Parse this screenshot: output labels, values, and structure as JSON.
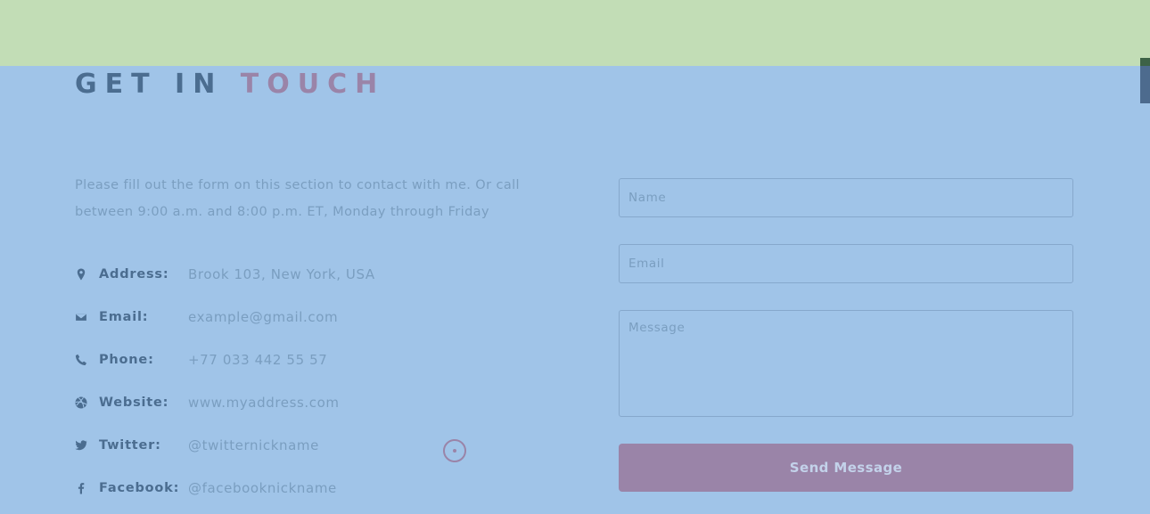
{
  "colors": {
    "background": "#a0c4e8",
    "top_band": "#c2ddb6",
    "heading": "#4b6d90",
    "accent": "#9a84a8",
    "muted_text": "#7a9ec0"
  },
  "section": {
    "title_part1": "GET IN",
    "title_part2": "TOUCH",
    "intro": "Please fill out the form on this section to contact with me. Or call between 9:00 a.m. and 8:00 p.m. ET, Monday through Friday"
  },
  "contact_info": [
    {
      "icon": "map-pin-icon",
      "label": "Address:",
      "value": "Brook 103, New York, USA"
    },
    {
      "icon": "envelope-icon",
      "label": "Email:",
      "value": "example@gmail.com"
    },
    {
      "icon": "phone-icon",
      "label": "Phone:",
      "value": "+77 033 442 55 57"
    },
    {
      "icon": "globe-icon",
      "label": "Website:",
      "value": "www.myaddress.com"
    },
    {
      "icon": "twitter-icon",
      "label": "Twitter:",
      "value": "@twitternickname"
    },
    {
      "icon": "facebook-icon",
      "label": "Facebook:",
      "value": "@facebooknickname"
    }
  ],
  "form": {
    "name_placeholder": "Name",
    "email_placeholder": "Email",
    "message_placeholder": "Message",
    "submit_label": "Send Message"
  }
}
